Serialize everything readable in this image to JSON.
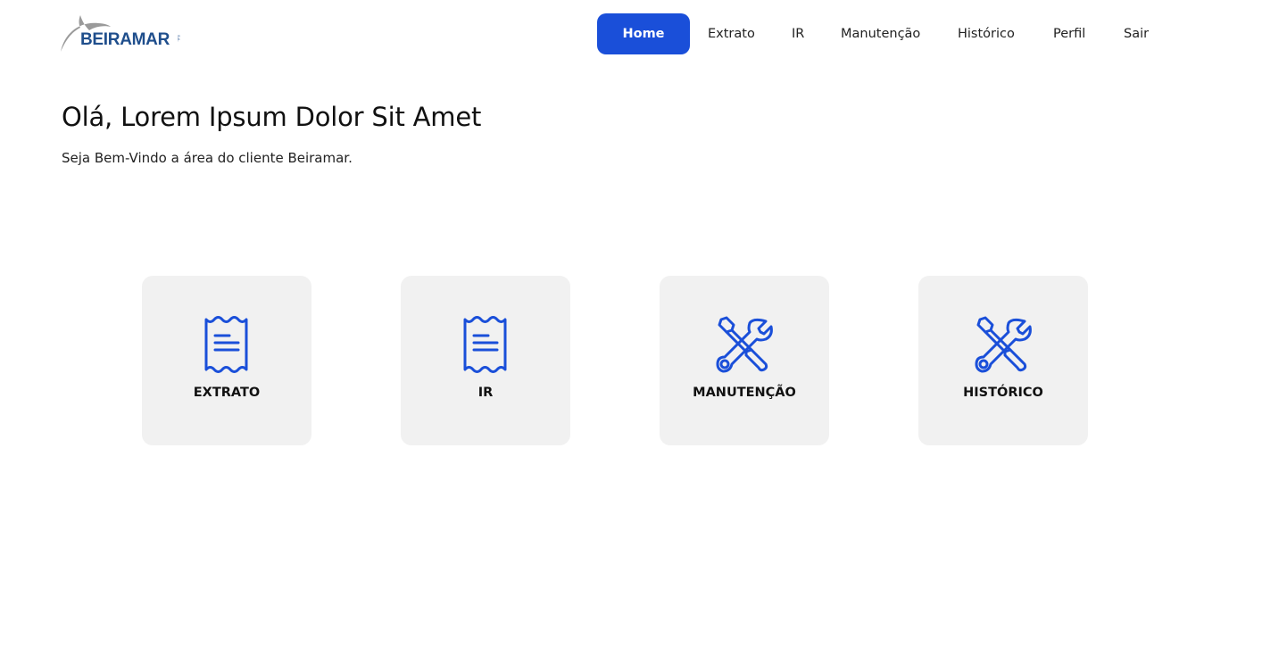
{
  "brand": {
    "name": "BEIRAMAR",
    "tagline": "S.A.",
    "primary_color": "#1a4fd9",
    "logo_color": "#1f4e8c"
  },
  "nav": {
    "items": [
      {
        "label": "Home",
        "active": true
      },
      {
        "label": "Extrato",
        "active": false
      },
      {
        "label": "IR",
        "active": false
      },
      {
        "label": "Manutenção",
        "active": false
      },
      {
        "label": "Histórico",
        "active": false
      },
      {
        "label": "Perfil",
        "active": false
      },
      {
        "label": "Sair",
        "active": false
      }
    ]
  },
  "main": {
    "greeting": "Olá, Lorem Ipsum Dolor Sit Amet",
    "subtitle": "Seja Bem-Vindo a área do cliente Beiramar."
  },
  "cards": [
    {
      "label": "EXTRATO",
      "icon": "receipt-icon"
    },
    {
      "label": "IR",
      "icon": "receipt-icon"
    },
    {
      "label": "MANUTENÇÃO",
      "icon": "tools-icon"
    },
    {
      "label": "HISTÓRICO",
      "icon": "tools-icon"
    }
  ]
}
